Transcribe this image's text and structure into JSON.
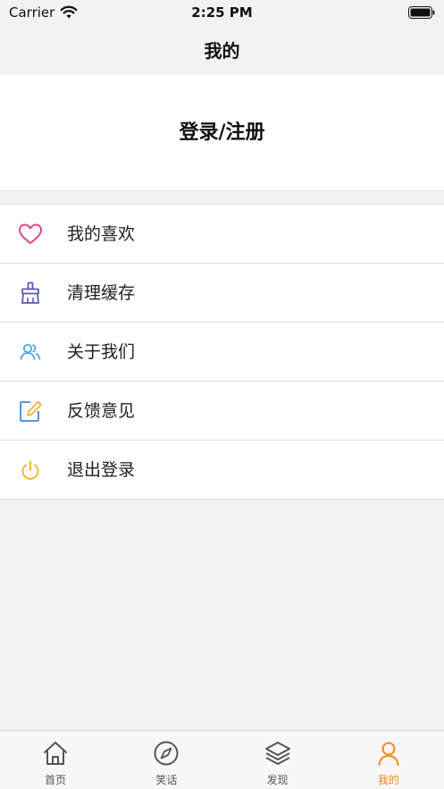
{
  "status_bar": {
    "carrier": "Carrier",
    "time": "2:25 PM"
  },
  "nav": {
    "title": "我的"
  },
  "login": {
    "label": "登录/注册"
  },
  "menu": {
    "items": [
      {
        "label": "我的喜欢",
        "icon": "heart-icon",
        "color": "#e0448b"
      },
      {
        "label": "清理缓存",
        "icon": "broom-icon",
        "color": "#5b57b8"
      },
      {
        "label": "关于我们",
        "icon": "users-icon",
        "color": "#3aa8d8"
      },
      {
        "label": "反馈意见",
        "icon": "edit-icon",
        "color": "#3d8ae6"
      },
      {
        "label": "退出登录",
        "icon": "power-icon",
        "color": "#f2b632"
      }
    ]
  },
  "tab_bar": {
    "active_color": "#f08a1c",
    "tabs": [
      {
        "label": "首页",
        "icon": "home-icon"
      },
      {
        "label": "笑话",
        "icon": "compass-icon"
      },
      {
        "label": "发现",
        "icon": "layers-icon"
      },
      {
        "label": "我的",
        "icon": "person-icon",
        "active": true
      }
    ]
  }
}
